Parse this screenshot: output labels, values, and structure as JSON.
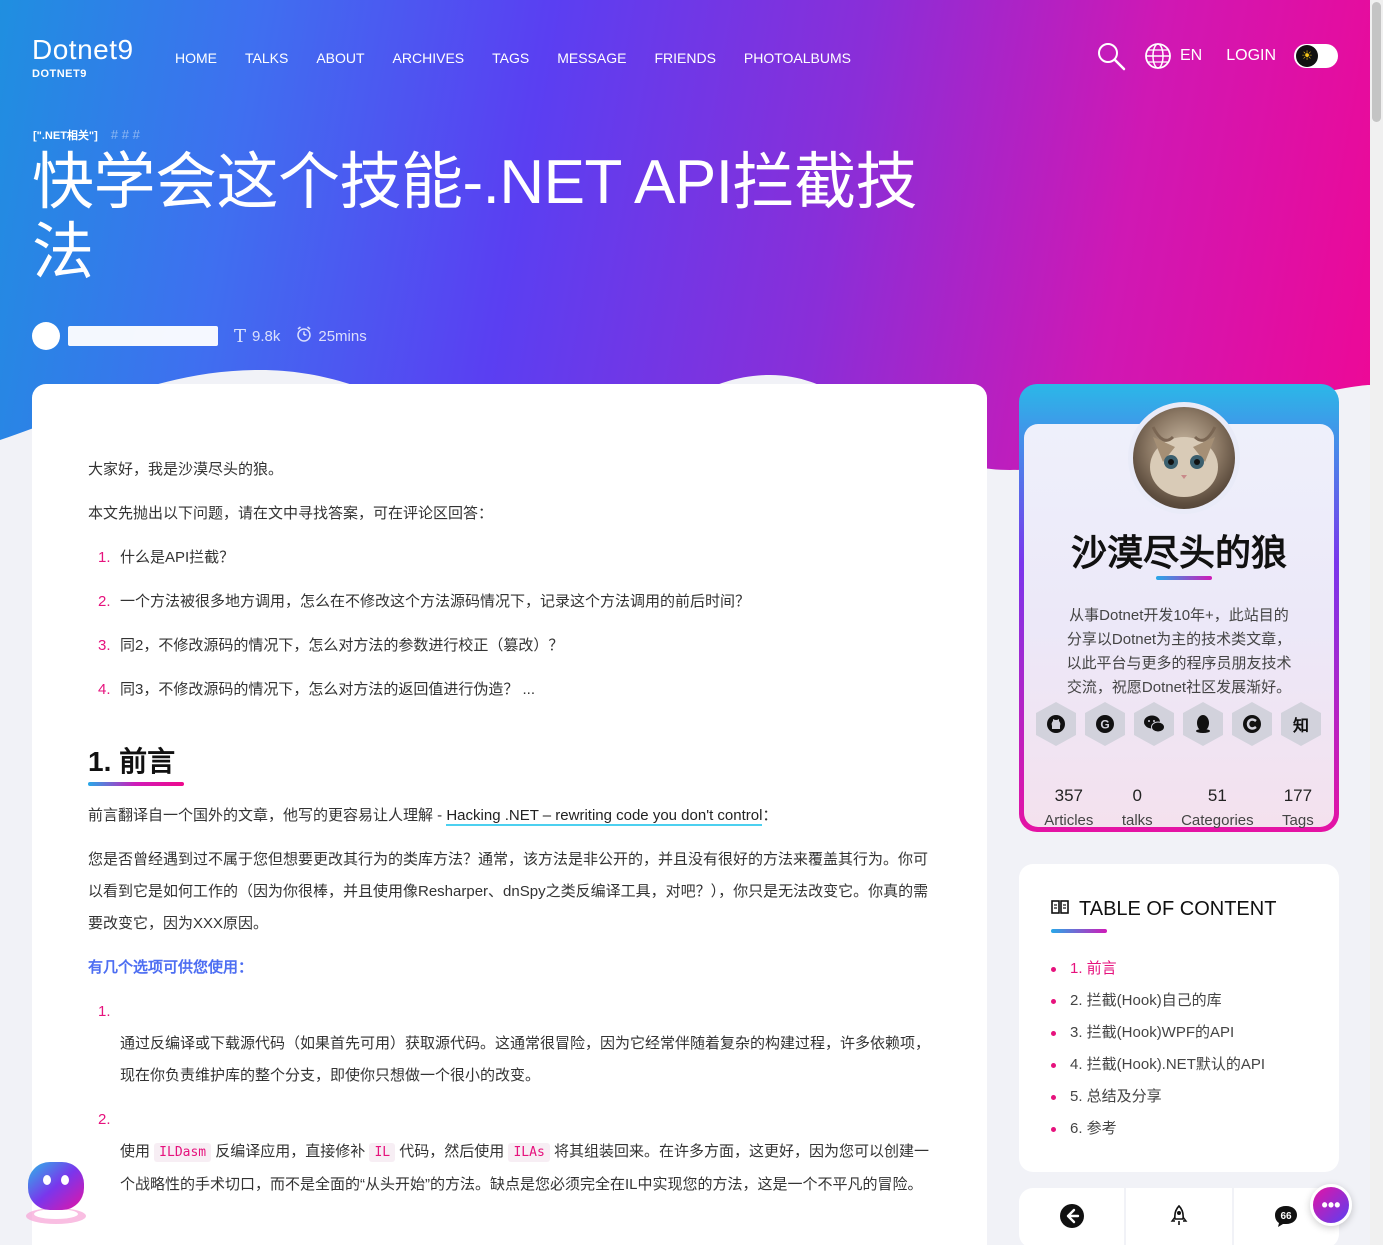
{
  "header": {
    "brand_name": "Dotnet9",
    "brand_sub": "DOTNET9",
    "nav": [
      "HOME",
      "TALKS",
      "ABOUT",
      "ARCHIVES",
      "TAGS",
      "MESSAGE",
      "FRIENDS",
      "PHOTOALBUMS"
    ],
    "lang": "EN",
    "login": "LOGIN"
  },
  "post": {
    "category": "[\".NET相关\"]",
    "hashes": "#  #  #",
    "title": "快学会这个技能-.NET API拦截技法",
    "words": "9.8k",
    "read_time": "25mins"
  },
  "article": {
    "greeting": "大家好，我是沙漠尽头的狼。",
    "intro": "本文先抛出以下问题，请在文中寻找答案，可在评论区回答：",
    "questions": [
      {
        "num": "1.",
        "text": "什么是API拦截？"
      },
      {
        "num": "2.",
        "text": "一个方法被很多地方调用，怎么在不修改这个方法源码情况下，记录这个方法调用的前后时间？"
      },
      {
        "num": "3.",
        "text": "同2，不修改源码的情况下，怎么对方法的参数进行校正（篡改）？"
      },
      {
        "num": "4.",
        "text": "同3，不修改源码的情况下，怎么对方法的返回值进行伪造？ ..."
      }
    ],
    "h2": "1. 前言",
    "preface_a": "前言翻译自一个国外的文章，他写的更容易让人理解 - ",
    "preface_link": "Hacking .NET – rewriting code you don't control",
    "preface_b": "：",
    "para": "您是否曾经遇到过不属于您但想要更改其行为的类库方法？通常，该方法是非公开的，并且没有很好的方法来覆盖其行为。你可以看到它是如何工作的（因为你很棒，并且使用像Resharper、dnSpy之类反编译工具，对吧？），你只是无法改变它。你真的需要改变它，因为XXX原因。",
    "options_title": "有几个选项可供您使用：",
    "option1_num": "1.",
    "option1": "通过反编译或下载源代码（如果首先可用）获取源代码。这通常很冒险，因为它经常伴随着复杂的构建过程，许多依赖项，现在你负责维护库的整个分支，即使你只想做一个很小的改变。",
    "option2_num": "2.",
    "option2_a": "使用 ",
    "option2_code1": "ILDasm",
    "option2_b": " 反编译应用，直接修补 ",
    "option2_code2": "IL",
    "option2_c": " 代码，然后使用 ",
    "option2_code3": "ILAs",
    "option2_d": " 将其组装回来。在许多方面，这更好，因为您可以创建一个战略性的手术切口，而不是全面的“从头开始”的方法。缺点是您必须完全在IL中实现您的方法，这是一个不平凡的冒险。"
  },
  "profile": {
    "name": "沙漠尽头的狼",
    "bio": "从事Dotnet开发10年+，此站目的分享以Dotnet为主的技术类文章，以此平台与更多的程序员朋友技术交流，祝愿Dotnet社区发展渐好。",
    "socials": [
      {
        "icon": "github-icon",
        "glyph": "◉"
      },
      {
        "icon": "gitee-icon",
        "glyph": "G"
      },
      {
        "icon": "wechat-icon",
        "glyph": "◕"
      },
      {
        "icon": "qq-icon",
        "glyph": "♟"
      },
      {
        "icon": "csdn-icon",
        "glyph": "C"
      },
      {
        "icon": "zhihu-icon",
        "glyph": "知"
      }
    ],
    "stats": [
      {
        "value": "357",
        "label": "Articles"
      },
      {
        "value": "0",
        "label": "talks"
      },
      {
        "value": "51",
        "label": "Categories"
      },
      {
        "value": "177",
        "label": "Tags"
      }
    ]
  },
  "toc": {
    "title": "TABLE OF CONTENT",
    "items": [
      "1. 前言",
      "2. 拦截(Hook)自己的库",
      "3. 拦截(Hook)WPF的API",
      "4. 拦截(Hook).NET默认的API",
      "5. 总结及分享",
      "6. 参考"
    ]
  },
  "colors": {
    "accent": "#e6127d",
    "link_underline": "#4cd0f0",
    "highlight_blue": "#4d6ef2"
  }
}
